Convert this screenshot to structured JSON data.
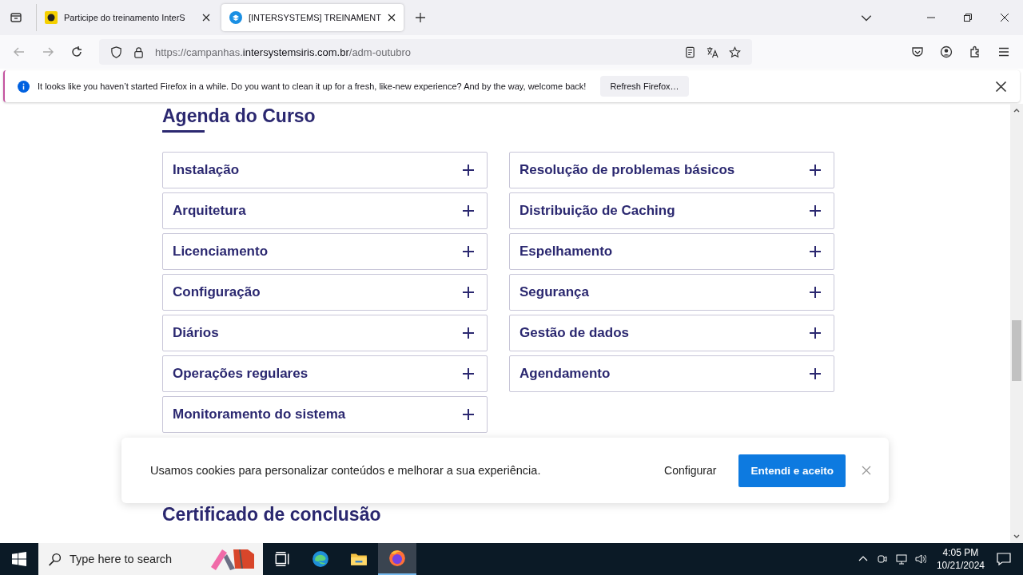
{
  "browser": {
    "tabs": [
      {
        "title": "Participe do treinamento InterS",
        "selected": false
      },
      {
        "title": "[INTERSYSTEMS] TREINAMENT",
        "selected": true
      }
    ],
    "url": {
      "prefix": "https://campanhas.",
      "domain": "intersystemsiris.com.br",
      "path": "/adm-outubro"
    }
  },
  "notification": {
    "text": "It looks like you haven’t started Firefox in a while. Do you want to clean it up for a fresh, like-new experience? And by the way, welcome back!",
    "button": "Refresh Firefox…"
  },
  "page": {
    "heading": "Agenda do Curso",
    "columns": [
      [
        {
          "label": "Instalação",
          "expanded": false
        },
        {
          "label": "Arquitetura",
          "expanded": false
        },
        {
          "label": "Licenciamento",
          "expanded": false
        },
        {
          "label": "Configuração",
          "expanded": false
        },
        {
          "label": "Diários",
          "expanded": false
        },
        {
          "label": "Operações regulares",
          "expanded": false
        },
        {
          "label": "Monitoramento do sistema",
          "expanded": false
        }
      ],
      [
        {
          "label": "Resolução de problemas básicos",
          "expanded": false
        },
        {
          "label": "Distribuição de Caching",
          "expanded": false
        },
        {
          "label": "Espelhamento",
          "expanded": false
        },
        {
          "label": "Segurança",
          "expanded": false
        },
        {
          "label": "Gestão de dados",
          "expanded": false
        },
        {
          "label": "Agendamento",
          "expanded": false
        }
      ]
    ],
    "next_heading": "Certificado de conclusão"
  },
  "cookie_banner": {
    "text": "Usamos cookies para personalizar conteúdos e melhorar a sua experiência.",
    "configure": "Configurar",
    "accept": "Entendi e aceito"
  },
  "taskbar": {
    "search_placeholder": "Type here to search",
    "time": "4:05 PM",
    "date": "10/21/2024"
  }
}
